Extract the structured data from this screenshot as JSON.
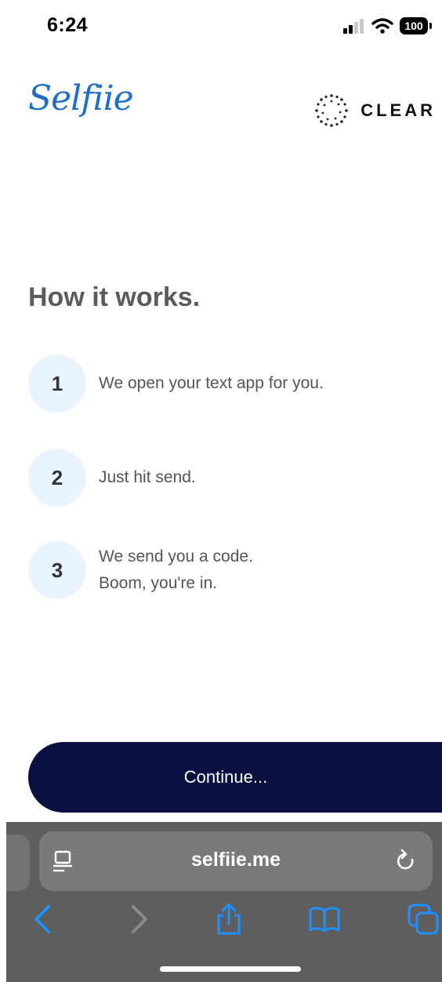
{
  "status_bar": {
    "time": "6:24",
    "battery": "100"
  },
  "header": {
    "brand_logo": "Selfiie",
    "partner_logo": "CLEAR"
  },
  "main": {
    "title": "How it works.",
    "steps": [
      {
        "number": "1",
        "line1": "We open your text app for you.",
        "line2": ""
      },
      {
        "number": "2",
        "line1": "Just hit send.",
        "line2": ""
      },
      {
        "number": "3",
        "line1": "We send you a code.",
        "line2": "Boom, you're in."
      }
    ],
    "continue_label": "Continue..."
  },
  "browser": {
    "url": "selfiie.me",
    "icons": [
      "reader-icon",
      "reload-icon",
      "back-icon",
      "forward-icon",
      "share-icon",
      "bookmarks-icon",
      "tabs-icon"
    ]
  },
  "colors": {
    "brand_blue": "#1d6fc9",
    "button_navy": "#0a1140",
    "step_circle": "#e8f3fd",
    "safari_bar": "#5e5e5e",
    "safari_blue": "#1e90ff"
  }
}
